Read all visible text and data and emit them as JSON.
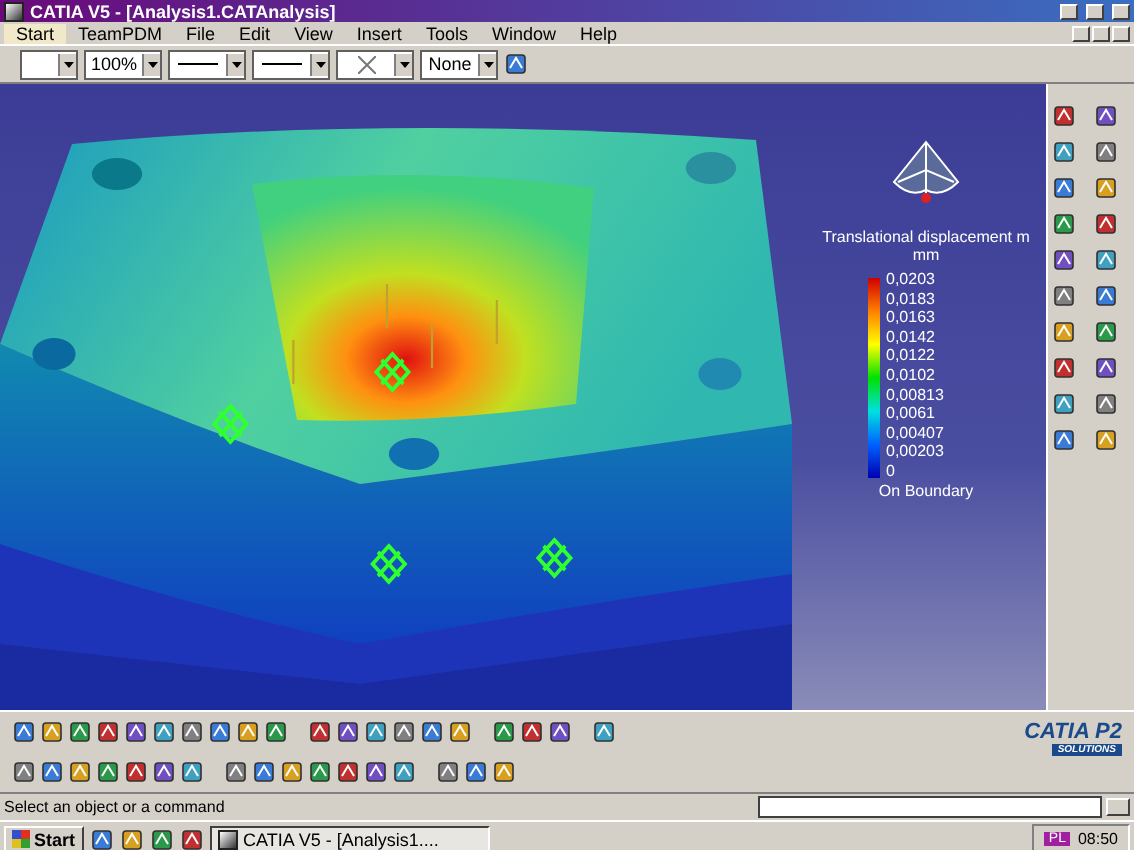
{
  "window": {
    "title": "CATIA V5 - [Analysis1.CATAnalysis]"
  },
  "menu": [
    {
      "label": "Start",
      "selected": true
    },
    {
      "label": "TeamPDM",
      "selected": false
    },
    {
      "label": "File",
      "selected": false
    },
    {
      "label": "Edit",
      "selected": false
    },
    {
      "label": "View",
      "selected": false
    },
    {
      "label": "Insert",
      "selected": false
    },
    {
      "label": "Tools",
      "selected": false
    },
    {
      "label": "Window",
      "selected": false
    },
    {
      "label": "Help",
      "selected": false
    }
  ],
  "format_toolbar": [
    {
      "kind": "color"
    },
    {
      "kind": "text",
      "value": "100%"
    },
    {
      "kind": "line"
    },
    {
      "kind": "line"
    },
    {
      "kind": "cross"
    },
    {
      "kind": "text",
      "value": "None"
    }
  ],
  "legend": {
    "title": "Translational displacement m",
    "unit": "mm",
    "values": [
      "0,0203",
      "0,0183",
      "0,0163",
      "0,0142",
      "0,0122",
      "0,0102",
      "0,00813",
      "0,0061",
      "0,00407",
      "0,00203",
      "0"
    ],
    "footer": "On Boundary"
  },
  "logo": {
    "name": "CATIA P2",
    "tagline": "SOLUTIONS"
  },
  "status_bar": {
    "message": "Select an object or a command"
  },
  "taskbar": {
    "start": "Start",
    "task": "CATIA V5 - [Analysis1....",
    "tray_badge": "PL",
    "clock": "08:50"
  }
}
